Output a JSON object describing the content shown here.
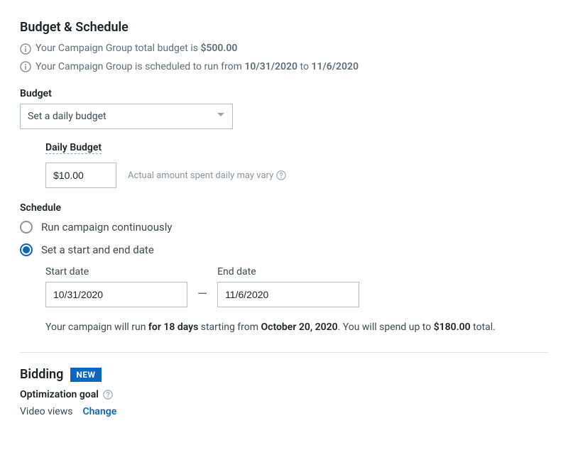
{
  "sections": {
    "budget_schedule": {
      "title": "Budget & Schedule",
      "info_budget": {
        "pre": "Your Campaign Group total budget is ",
        "bold": "$500.00"
      },
      "info_schedule": {
        "pre": "Your Campaign Group is scheduled to run from ",
        "d1": "10/31/2020",
        "mid": " to ",
        "d2": "11/6/2020"
      },
      "budget_label": "Budget",
      "budget_select": {
        "value": "Set a daily budget"
      },
      "daily_budget_label": "Daily Budget",
      "daily_budget_value": "$10.00",
      "daily_budget_hint": "Actual amount spent daily may vary",
      "schedule_label": "Schedule",
      "radios": {
        "continuous": "Run campaign continuously",
        "start_end": "Set a start and end date"
      },
      "start_date_label": "Start date",
      "start_date_value": "10/31/2020",
      "dash": "—",
      "end_date_label": "End date",
      "end_date_value": "11/6/2020",
      "summary": {
        "p1": "Your campaign will run ",
        "b1": "for 18 days",
        "p2": " starting from ",
        "b2": "October 20, 2020",
        "p3": ". You will spend up to ",
        "b3": "$180.00",
        "p4": " total."
      }
    },
    "bidding": {
      "title": "Bidding",
      "badge": "NEW",
      "opt_goal_label": "Optimization goal",
      "opt_goal_value": "Video views",
      "change_text": "Change"
    }
  }
}
